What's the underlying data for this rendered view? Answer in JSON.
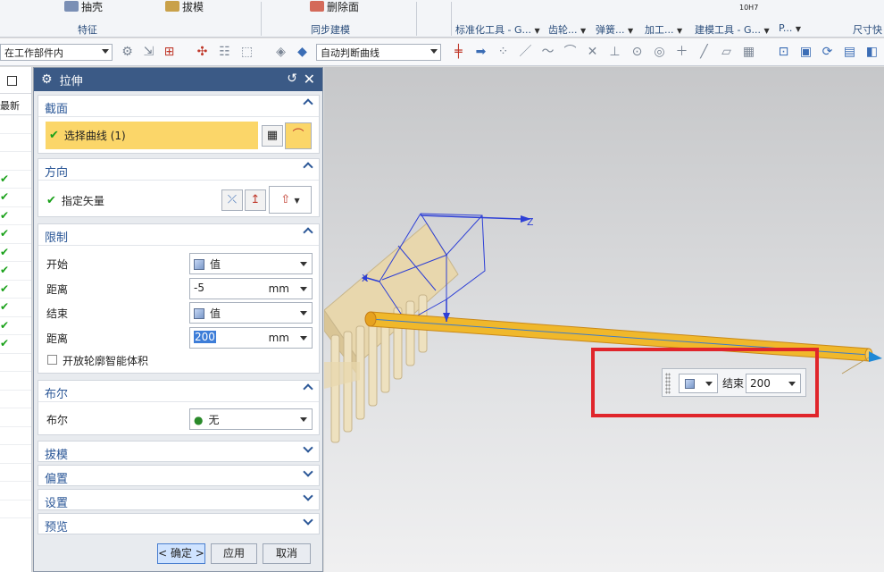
{
  "ribbon": {
    "commands": [
      {
        "label": "抽壳",
        "icon": "shell-icon"
      },
      {
        "label": "拔模",
        "icon": "draft-icon"
      },
      {
        "label": "删除面",
        "icon": "delete-face-icon"
      }
    ],
    "groups": {
      "feature": "特征",
      "sync_modeling": "同步建模",
      "std_tools": "标准化工具 - G...",
      "gear": "齿轮...",
      "spring": "弹簧...",
      "machining": "加工...",
      "modeling_tools": "建模工具 - G...",
      "p": "P...",
      "dimension_quick": "尺寸快",
      "tolerance": "10H7"
    }
  },
  "toolbar": {
    "scope_value": "在工作部件内",
    "curve_rule_value": "自动判断曲线"
  },
  "left_strip": {
    "column_header": "最新",
    "check_symbol": "✔"
  },
  "dialog": {
    "title": "拉伸",
    "sections": {
      "section": {
        "title": "截面",
        "select_curve": "选择曲线 (1)"
      },
      "direction": {
        "title": "方向",
        "specify_vector": "指定矢量"
      },
      "limits": {
        "title": "限制",
        "start_label": "开始",
        "start_value": "值",
        "start_distance_label": "距离",
        "start_distance": "-5",
        "start_unit": "mm",
        "end_label": "结束",
        "end_value": "值",
        "end_distance_label": "距离",
        "end_distance": "200",
        "end_unit": "mm",
        "open_profile": "开放轮廓智能体积"
      },
      "boolean": {
        "title": "布尔",
        "label": "布尔",
        "value": "无"
      }
    },
    "collapsed": {
      "draft": "拔模",
      "offset": "偏置",
      "settings": "设置",
      "preview": "预览"
    },
    "buttons": {
      "ok": "< 确定 >",
      "apply": "应用",
      "cancel": "取消"
    }
  },
  "viewport": {
    "axis_labels": {
      "z": "Z",
      "x": "X"
    },
    "onscreen_end_label": "结束",
    "onscreen_end_value": "200"
  }
}
